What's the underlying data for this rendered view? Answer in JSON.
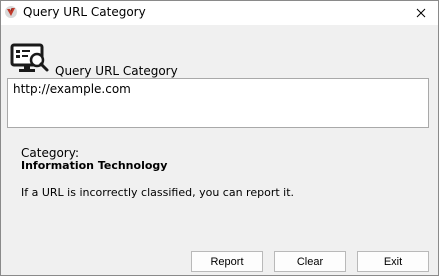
{
  "window": {
    "title": "Query URL Category"
  },
  "header": {
    "label": "Query URL Category"
  },
  "url_input": {
    "value": "http://example.com"
  },
  "result": {
    "category_label": "Category:",
    "category_value": "Information Technology",
    "report_note": "If a URL is incorrectly classified, you can report it."
  },
  "buttons": {
    "report": "Report",
    "clear": "Clear",
    "exit": "Exit"
  },
  "icons": {
    "app": "app-logo-icon",
    "close": "close-icon",
    "monitor": "monitor-search-icon"
  },
  "colors": {
    "dialog_background": "#f0f0f0",
    "titlebar_background": "#ffffff",
    "app_icon_red": "#c0392b"
  }
}
